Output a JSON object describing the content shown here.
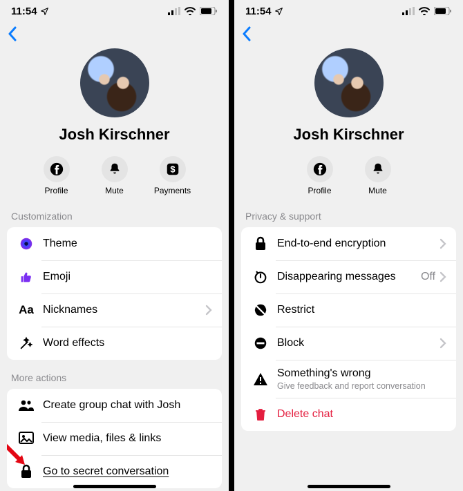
{
  "statusbar": {
    "time": "11:54"
  },
  "profile": {
    "name": "Josh Kirschner"
  },
  "left": {
    "actions": {
      "profile": "Profile",
      "mute": "Mute",
      "payments": "Payments"
    },
    "sections": {
      "customization": "Customization",
      "more_actions": "More actions"
    },
    "rows": {
      "theme": "Theme",
      "emoji": "Emoji",
      "nicknames": "Nicknames",
      "word_effects": "Word effects",
      "create_group": "Create group chat with Josh",
      "view_media": "View media, files & links",
      "secret": "Go to secret conversation"
    }
  },
  "right": {
    "actions": {
      "profile": "Profile",
      "mute": "Mute"
    },
    "sections": {
      "privacy": "Privacy & support"
    },
    "rows": {
      "e2e": "End-to-end encryption",
      "disappearing": "Disappearing messages",
      "disappearing_value": "Off",
      "restrict": "Restrict",
      "block": "Block",
      "wrong": "Something's wrong",
      "wrong_sub": "Give feedback and report conversation",
      "delete": "Delete chat"
    }
  }
}
